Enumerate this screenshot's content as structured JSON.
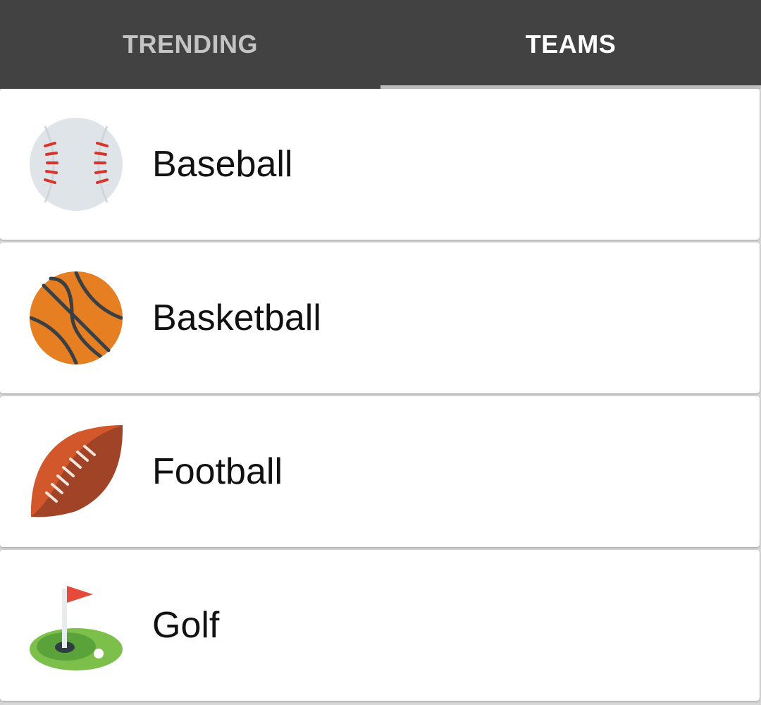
{
  "tabs": [
    {
      "label": "TRENDING",
      "selected": false
    },
    {
      "label": "TEAMS",
      "selected": true
    }
  ],
  "sports": [
    {
      "label": "Baseball",
      "icon": "baseball-icon"
    },
    {
      "label": "Basketball",
      "icon": "basketball-icon"
    },
    {
      "label": "Football",
      "icon": "football-icon"
    },
    {
      "label": "Golf",
      "icon": "golf-icon"
    }
  ],
  "colors": {
    "tabbar": "#424242",
    "tab_inactive_text": "#c4c4c4",
    "tab_active_text": "#ffffff",
    "indicator": "#bdbdbd"
  }
}
